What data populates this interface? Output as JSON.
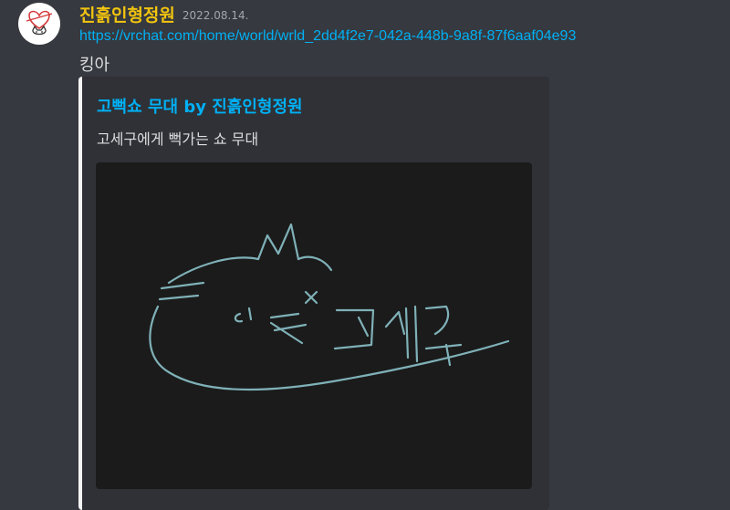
{
  "message": {
    "author": "진흙인형정원",
    "author_color": "#f1c40f",
    "timestamp": "2022.08.14.",
    "link_url": "https://vrchat.com/home/world/wrld_2dd4f2e7-042a-448b-9a8f-87f6aaf04e93",
    "text": "킹아"
  },
  "embed": {
    "title": "고뻑쇼 무대 by 진흙인형정원",
    "description": "고세구에게 뻑가는 쇼 무대",
    "image_doodle_text": "고세구",
    "border_color": "#f4f4f4"
  }
}
